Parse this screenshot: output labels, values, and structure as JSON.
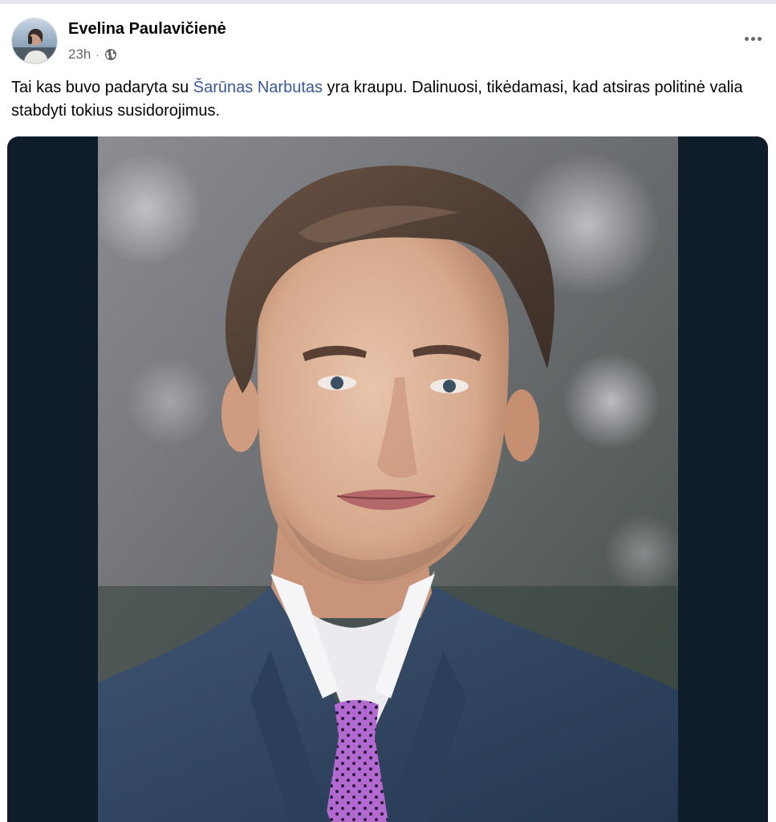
{
  "post": {
    "author": "Evelina Paulavičienė",
    "timestamp": "23h",
    "separator": "·",
    "privacy_icon": "globe-icon",
    "more_icon": "more-options-icon",
    "text_before_mention": "Tai kas buvo padaryta su ",
    "mention": "Šarūnas Narbutas",
    "text_after_mention": " yra kraupu. Dalinuosi, tikėdamasi, kad atsiras politinė valia stabdyti tokius susidorojimus.",
    "photo": "portrait-photo"
  },
  "colors": {
    "mention": "#385898",
    "secondary_text": "#65676b",
    "media_background": "#0f1c2a"
  }
}
